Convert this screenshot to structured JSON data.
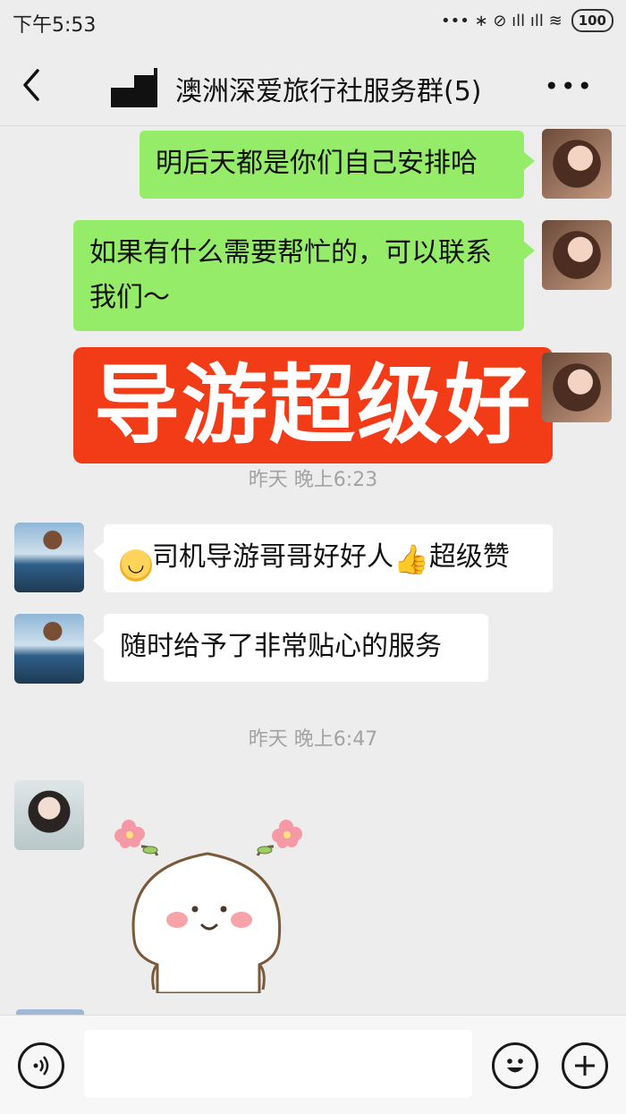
{
  "status_bar": {
    "time": "下午5:53",
    "signal_glyphs": "••• ∗ ⊘ ıll ıll ≋",
    "battery": "100"
  },
  "header": {
    "title": "澳洲深爱旅行社服务群(5)",
    "more": "•••"
  },
  "messages": [
    {
      "side": "right",
      "text": "明后天都是你们自己安排哈"
    },
    {
      "side": "right",
      "text": "如果有什么需要帮忙的，可以联系我们～"
    },
    {
      "side": "right",
      "text": "导游超级好",
      "style": "big-red-banner"
    },
    {
      "type": "time",
      "text": "昨天 晚上6:23"
    },
    {
      "side": "left",
      "text": "司机导游哥哥好好人",
      "text_after_icon": "超级赞"
    },
    {
      "side": "left",
      "text": "随时给予了非常贴心的服务"
    },
    {
      "type": "time",
      "text": "昨天 晚上6:47"
    },
    {
      "side": "left",
      "type": "sticker",
      "icon": "cute-bun-sticker"
    }
  ],
  "colors": {
    "background": "#ededed",
    "bubble_green": "#95ec69",
    "bubble_white": "#ffffff",
    "banner_red": "#f13c17"
  },
  "bottom_bar": {
    "voice_icon": "voice-icon",
    "emoji_icon": "emoji-icon",
    "plus_icon": "plus-icon"
  }
}
